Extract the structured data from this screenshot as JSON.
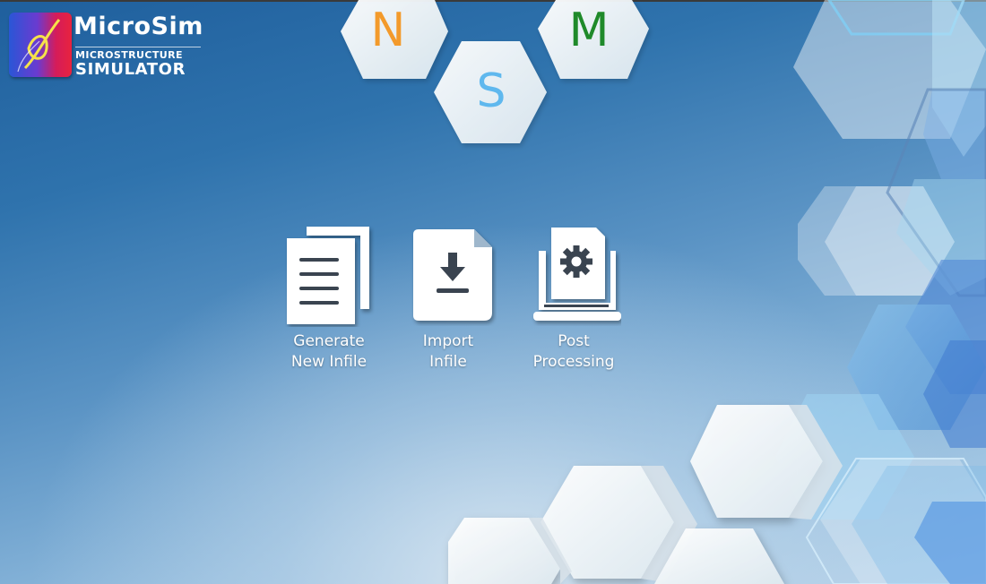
{
  "app": {
    "logo_title": "MicroSim",
    "logo_subtitle_top": "MICROSTRUCTURE",
    "logo_subtitle_bottom": "SIMULATOR"
  },
  "header_hexagons": {
    "n": {
      "letter": "N",
      "color": "#f39a2b"
    },
    "s": {
      "letter": "S",
      "color": "#5fb8ee"
    },
    "m": {
      "letter": "M",
      "color": "#1f8a2a"
    }
  },
  "actions": [
    {
      "id": "generate",
      "icon": "documents-icon",
      "line1": "Generate",
      "line2": "New Infile"
    },
    {
      "id": "import",
      "icon": "import-file-icon",
      "line1": "Import",
      "line2": "Infile"
    },
    {
      "id": "post",
      "icon": "laptop-gear-icon",
      "line1": "Post",
      "line2": "Processing"
    }
  ]
}
